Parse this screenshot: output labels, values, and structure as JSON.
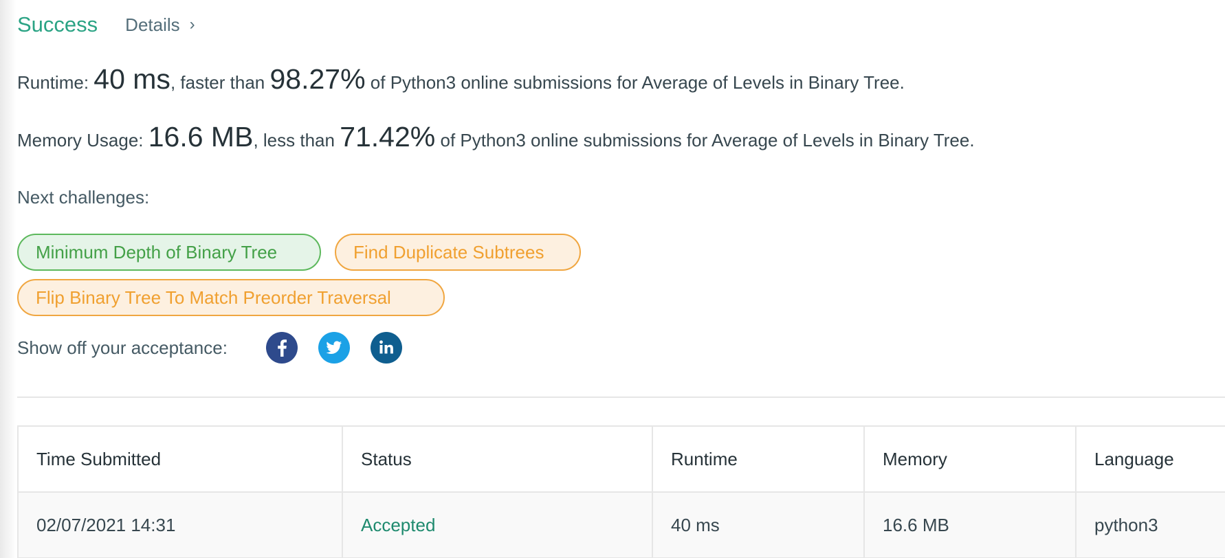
{
  "header": {
    "status": "Success",
    "details_label": "Details",
    "details_chevron": "›"
  },
  "runtime_line": {
    "label": "Runtime:",
    "value": "40 ms",
    "middle": ", faster than",
    "percent": "98.27%",
    "tail": "of Python3 online submissions for Average of Levels in Binary Tree."
  },
  "memory_line": {
    "label": "Memory Usage:",
    "value": "16.6 MB",
    "middle": ", less than",
    "percent": "71.42%",
    "tail": "of Python3 online submissions for Average of Levels in Binary Tree."
  },
  "next_challenges": {
    "label": "Next challenges:",
    "items": [
      {
        "label": "Minimum Depth of Binary Tree",
        "difficulty_color": "#5cb85c"
      },
      {
        "label": "Find Duplicate Subtrees",
        "difficulty_color": "#f0a640"
      },
      {
        "label": "Flip Binary Tree To Match Preorder Traversal",
        "difficulty_color": "#f0a640"
      }
    ]
  },
  "share": {
    "label": "Show off your acceptance:",
    "icons": [
      "facebook-icon",
      "twitter-icon",
      "linkedin-icon"
    ]
  },
  "submissions_table": {
    "columns": [
      "Time Submitted",
      "Status",
      "Runtime",
      "Memory",
      "Language"
    ],
    "rows": [
      {
        "time": "02/07/2021 14:31",
        "status": "Accepted",
        "runtime": "40 ms",
        "memory": "16.6 MB",
        "language": "python3"
      }
    ]
  },
  "colors": {
    "success": "#2aa384",
    "accepted": "#1e8a6e",
    "easy": "#5cb85c",
    "medium": "#f0a640",
    "facebook": "#2e4a8c",
    "twitter": "#1ba1e6",
    "linkedin": "#0f5e8f"
  }
}
